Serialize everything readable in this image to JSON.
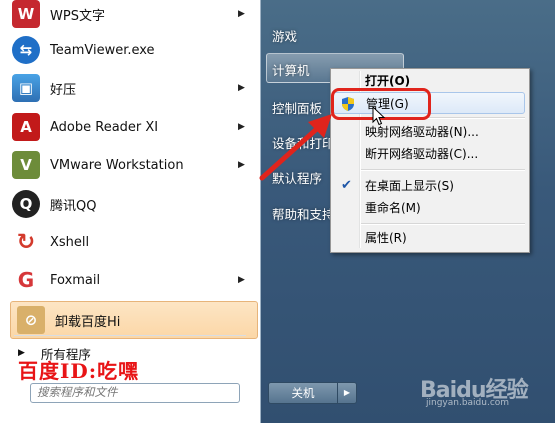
{
  "start_menu": {
    "programs": [
      {
        "label": "WPS文字",
        "icon": "wps-icon",
        "color": "#c5282f",
        "has_submenu": true
      },
      {
        "label": "TeamViewer.exe",
        "icon": "teamviewer-icon",
        "color": "#1f6fc7",
        "has_submenu": false
      },
      {
        "label": "好压",
        "icon": "haozip-icon",
        "color": "#3d8fd1",
        "has_submenu": true
      },
      {
        "label": "Adobe Reader XI",
        "icon": "adobe-reader-icon",
        "color": "#c21a1a",
        "has_submenu": true
      },
      {
        "label": "VMware Workstation",
        "icon": "vmware-icon",
        "color": "#6d8c3a",
        "has_submenu": true
      },
      {
        "label": "腾讯QQ",
        "icon": "qq-icon",
        "color": "#222222",
        "has_submenu": false
      },
      {
        "label": "Xshell",
        "icon": "xshell-icon",
        "color": "#d33a2c",
        "has_submenu": false
      },
      {
        "label": "Foxmail",
        "icon": "foxmail-icon",
        "color": "#d6373a",
        "has_submenu": true
      },
      {
        "label": "卸载百度Hi",
        "icon": "uninstall-icon",
        "color": "#b88a3a",
        "has_submenu": false
      }
    ],
    "all_programs": "所有程序",
    "search_placeholder": "搜索程序和文件",
    "right_items": [
      "游戏",
      "计算机",
      "控制面板",
      "设备和打印",
      "默认程序",
      "帮助和支持"
    ],
    "shutdown_label": "关机"
  },
  "context_menu": {
    "items": [
      {
        "label": "打开(O)",
        "bold": true
      },
      {
        "label": "管理(G)",
        "icon": "shield-icon",
        "hover": true
      },
      {
        "separator": true
      },
      {
        "label": "映射网络驱动器(N)..."
      },
      {
        "label": "断开网络驱动器(C)..."
      },
      {
        "separator": true
      },
      {
        "label": "在桌面上显示(S)",
        "checked": true
      },
      {
        "label": "重命名(M)"
      },
      {
        "separator": true
      },
      {
        "label": "属性(R)"
      }
    ]
  },
  "annotations": {
    "baidu_id": "百度ID:吃嘿",
    "watermark": "Baidu经验",
    "watermark_sub": "jingyan.baidu.com"
  },
  "colors": {
    "annotation_red": "#e0241c",
    "highlight_orange": "#fbd7a7",
    "panel_blue": "#39597a"
  }
}
